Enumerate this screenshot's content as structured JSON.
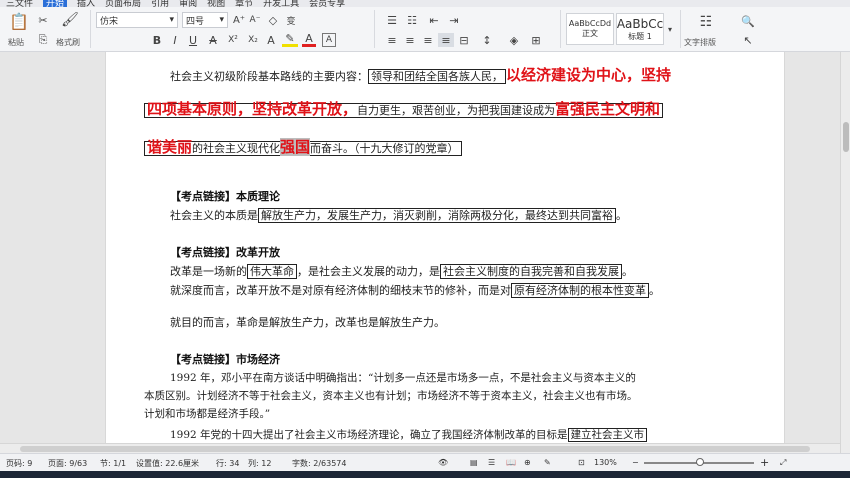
{
  "menubar": {
    "items": [
      "三文件",
      "开始",
      "插入",
      "页面布局",
      "引用",
      "审阅",
      "视图",
      "章节",
      "开发工具",
      "会员专享"
    ],
    "active": "开始"
  },
  "ribbon": {
    "paste_label": "粘贴",
    "format_painter_label": "格式刷",
    "font_name": "仿宋",
    "font_size": "四号",
    "style_normal_preview": "AaBbCcDd",
    "style_normal_label": "正文",
    "style_h1_preview": "AaBbCc",
    "style_h1_label": "标题 1",
    "text_layout_label": "文字排版"
  },
  "document": {
    "p1_l1_a": "社会主义初级阶段基本路线的主要内容：",
    "p1_l1_b": "领导和团结全国各族人民，",
    "p1_l1_c": "以经济建设为中心，坚持",
    "p1_l2_a": "四项基本原则，坚持改革开放，",
    "p1_l2_b": "自力更生，艰苦创业，为把我国建设成为",
    "p1_l2_c": "富强民主文明和",
    "p1_l3_a": "谐美丽",
    "p1_l3_b": "的社会主义现代化",
    "p1_l3_c": "强国",
    "p1_l3_d": "而奋斗。（十九大修订的党章）",
    "s1_head": "【考点链接】本质理论",
    "s1_l1_a": "社会主义的本质是",
    "s1_l1_b": "解放生产力，发展生产力，消灭剥削，消除两极分化，最终达到共同富裕",
    "s1_l1_c": "。",
    "s2_head": "【考点链接】改革开放",
    "s2_l1_a": "改革是一场新的",
    "s2_l1_b": "伟大革命",
    "s2_l1_c": "，是社会主义发展的动力，是",
    "s2_l1_d": "社会主义制度的自我完善和自我发展",
    "s2_l1_e": "。",
    "s2_l2_a": "就深度而言，改革开放不是对原有经济体制的细枝末节的修补，而是对",
    "s2_l2_b": "原有经济体制的根本性变革",
    "s2_l2_c": "。",
    "s2_l3": "就目的而言，革命是解放生产力，改革也是解放生产力。",
    "s3_head": "【考点链接】市场经济",
    "s3_l1": "1992 年，邓小平在南方谈话中明确指出：“计划多一点还是市场多一点，不是社会主义与资本主义的",
    "s3_l2": "本质区别。计划经济不等于社会主义，资本主义也有计划；市场经济不等于资本主义，社会主义也有市场。",
    "s3_l3": "计划和市场都是经济手段。”",
    "s3_l4_a": "1992 年党的十四大提出了社会主义市场经济理论，确立了我国经济体制改革的目标是",
    "s3_l4_b": "建立社会主义市"
  },
  "status": {
    "page": "页码: 9",
    "pages": "页面: 9/63",
    "section": "节: 1/1",
    "position": "设置值: 22.6厘米",
    "row": "行: 34",
    "col": "列: 12",
    "words": "字数: 2/63574",
    "zoom": "130%"
  }
}
